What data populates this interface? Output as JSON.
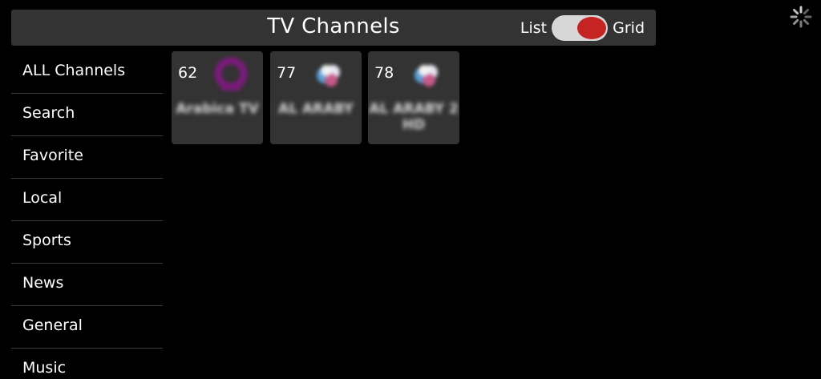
{
  "header": {
    "title": "TV Channels",
    "toggle": {
      "left_label": "List",
      "right_label": "Grid",
      "selected": "Grid"
    }
  },
  "status": {
    "loading_icon": "spinner-icon"
  },
  "sidebar": {
    "items": [
      {
        "label": "ALL Channels"
      },
      {
        "label": "Search"
      },
      {
        "label": "Favorite"
      },
      {
        "label": "Local"
      },
      {
        "label": "Sports"
      },
      {
        "label": "News"
      },
      {
        "label": "General"
      },
      {
        "label": "Music"
      }
    ]
  },
  "channels": [
    {
      "number": "62",
      "name": "Arabica TV",
      "logo": "arabica-logo",
      "logo_color": "#7a1b7a"
    },
    {
      "number": "77",
      "name": "AL ARABY",
      "logo": "al-araby-logo",
      "logo_color": "#5aa0d8"
    },
    {
      "number": "78",
      "name": "AL ARABY 2 HD",
      "logo": "al-araby-logo",
      "logo_color": "#5aa0d8"
    }
  ],
  "colors": {
    "accent": "#c62323",
    "panel": "#333333",
    "background": "#000000"
  }
}
